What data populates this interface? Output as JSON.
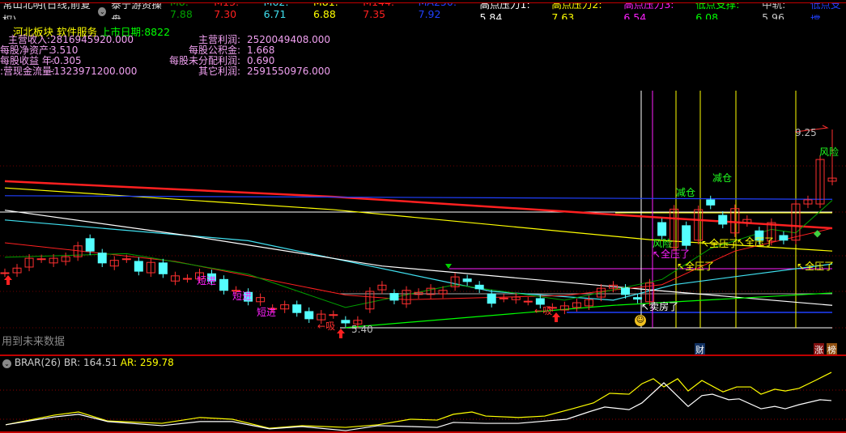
{
  "header": {
    "title": "常山北明(日线,前复权)",
    "indicator_name": "泰宁游资操盘",
    "items": [
      {
        "label": "M8: 7.88",
        "color": "#00a000"
      },
      {
        "label": "M13: 7.30",
        "color": "#ff2020"
      },
      {
        "label": "M62: 6.71",
        "color": "#40e0f0"
      },
      {
        "label": "M81: 6.88",
        "color": "#ffff00"
      },
      {
        "label": "M144: 7.35",
        "color": "#ff2020"
      },
      {
        "label": "MA250: 7.92",
        "color": "#2040ff"
      },
      {
        "label": "高点压力1: 5.84",
        "color": "#ffffff"
      },
      {
        "label": "高点压力2: 7.63",
        "color": "#ffff00"
      },
      {
        "label": "高点压力3: 6.54",
        "color": "#ff20ff"
      },
      {
        "label": "低点支撑: 6.08",
        "color": "#00ff00"
      },
      {
        "label": "中轨: 5.96",
        "color": "#c8c8c8"
      },
      {
        "label": "低点支撑",
        "color": "#2040ff"
      }
    ]
  },
  "info": {
    "sector": "河北板块",
    "industry": "软件服务",
    "listing": "上市日期:8822",
    "rows": [
      [
        "主营收入:",
        "2816945920.000",
        "主营利润:",
        "2520049408.000"
      ],
      [
        "每股净资产:",
        "3.510",
        "每股公积金:",
        "1.668"
      ],
      [
        "每股收益 年:",
        "-0.305",
        "每股未分配利润:",
        "0.690"
      ],
      [
        ":营现金流量:",
        "-1323971200.000",
        "其它利润:",
        "2591550976.000"
      ]
    ]
  },
  "annotations": {
    "future_data": "用到未来数据",
    "high_price": "9.25",
    "low_price": "5.40",
    "risk": "风险",
    "reduce": "减仓",
    "full": "全压了",
    "sell_house": "卖房了",
    "short_in": "短进",
    "absorb": "吸",
    "cai": "财",
    "zhang": "涨",
    "bang": "榜"
  },
  "brar": {
    "title": "BRAR(26)",
    "br": "BR: 164.51",
    "ar": "AR: 259.78"
  },
  "colors": {
    "up": "#ff3030",
    "down": "#54ffff",
    "bg": "#000000"
  },
  "chart_data": {
    "type": "candlestick",
    "price_range": [
      5.4,
      9.25
    ],
    "candles": [
      [
        6.48,
        6.48
      ],
      [
        6.48,
        6.57
      ],
      [
        6.59,
        6.76
      ],
      [
        6.75,
        6.75
      ],
      [
        6.67,
        6.76
      ],
      [
        6.7,
        6.79
      ],
      [
        6.79,
        7.0
      ],
      [
        7.14,
        6.9
      ],
      [
        6.86,
        6.67
      ],
      [
        6.61,
        6.72
      ],
      [
        6.75,
        6.75
      ],
      [
        6.7,
        6.51
      ],
      [
        6.48,
        6.68
      ],
      [
        6.67,
        6.46
      ],
      [
        6.32,
        6.42
      ],
      [
        6.37,
        6.37
      ],
      [
        6.36,
        6.48
      ],
      [
        6.46,
        6.32
      ],
      [
        6.35,
        6.14
      ],
      [
        6.14,
        6.14
      ],
      [
        6.1,
        5.93
      ],
      [
        5.92,
        6.0
      ],
      [
        5.79,
        5.79
      ],
      [
        5.78,
        5.86
      ],
      [
        5.86,
        5.71
      ],
      [
        5.73,
        5.59
      ],
      [
        5.57,
        5.68
      ],
      [
        5.67,
        5.67
      ],
      [
        5.56,
        5.51
      ],
      [
        5.49,
        5.56
      ],
      [
        5.78,
        6.12
      ],
      [
        6.15,
        6.24
      ],
      [
        6.08,
        5.95
      ],
      [
        5.88,
        6.14
      ],
      [
        6.06,
        6.1
      ],
      [
        6.06,
        6.18
      ],
      [
        6.07,
        6.14
      ],
      [
        6.21,
        6.4
      ],
      [
        6.36,
        6.31
      ],
      [
        6.24,
        6.17
      ],
      [
        6.07,
        5.89
      ],
      [
        5.99,
        5.99
      ],
      [
        5.96,
        6.01
      ],
      [
        5.93,
        5.93
      ],
      [
        5.98,
        5.87
      ],
      [
        5.81,
        5.81
      ],
      [
        5.76,
        5.84
      ],
      [
        5.81,
        5.9
      ],
      [
        5.84,
        5.96
      ],
      [
        6.01,
        6.18
      ],
      [
        6.18,
        6.24
      ],
      [
        6.18,
        6.06
      ],
      [
        6.0,
        5.97
      ],
      [
        5.92,
        6.28
      ],
      [
        7.45,
        7.2
      ],
      [
        6.97,
        7.71
      ],
      [
        7.39,
        7.01
      ],
      [
        7.11,
        7.7
      ],
      [
        7.89,
        7.79
      ],
      [
        7.59,
        7.42
      ],
      [
        7.25,
        7.72
      ],
      [
        7.45,
        7.51
      ],
      [
        7.29,
        7.11
      ],
      [
        7.09,
        7.45
      ],
      [
        7.2,
        7.11
      ],
      [
        7.11,
        7.81
      ],
      [
        7.81,
        7.89
      ],
      [
        7.81,
        8.67
      ],
      [
        8.25,
        8.31
      ]
    ],
    "lines": [
      {
        "name": "M144",
        "color": "#ff2020",
        "width": 2.5,
        "points": [
          [
            0,
            8.25
          ],
          [
            27,
            7.95
          ],
          [
            53,
            7.56
          ],
          [
            68,
            7.34
          ]
        ]
      },
      {
        "name": "M81",
        "color": "#ffff00",
        "width": 1.2,
        "points": [
          [
            0,
            8.12
          ],
          [
            27,
            7.7
          ],
          [
            53,
            7.12
          ],
          [
            68,
            6.9
          ]
        ]
      },
      {
        "name": "MA250",
        "color": "#2040ff",
        "width": 1.2,
        "points": [
          [
            0,
            7.97
          ],
          [
            40,
            7.93
          ],
          [
            68,
            7.9
          ]
        ]
      },
      {
        "name": "M62",
        "color": "#40e0f0",
        "width": 1.2,
        "points": [
          [
            0,
            7.5
          ],
          [
            20,
            7.1
          ],
          [
            40,
            6.12
          ],
          [
            50,
            5.95
          ],
          [
            55,
            6.25
          ],
          [
            68,
            6.65
          ]
        ]
      },
      {
        "name": "mid",
        "color": "#ffffff",
        "width": 1.2,
        "points": [
          [
            0,
            7.69
          ],
          [
            15,
            7.2
          ],
          [
            31,
            6.61
          ],
          [
            53,
            6.15
          ],
          [
            68,
            5.85
          ]
        ]
      },
      {
        "name": "M13",
        "color": "#ff2020",
        "width": 1,
        "points": [
          [
            0,
            7.06
          ],
          [
            14,
            6.7
          ],
          [
            28,
            6.05
          ],
          [
            33,
            5.96
          ],
          [
            46,
            6.04
          ],
          [
            54,
            6.25
          ],
          [
            60,
            6.9
          ],
          [
            68,
            7.34
          ]
        ]
      },
      {
        "name": "M8",
        "color": "#00a000",
        "width": 1,
        "points": [
          [
            0,
            6.78
          ],
          [
            10,
            6.85
          ],
          [
            20,
            6.45
          ],
          [
            28,
            5.81
          ],
          [
            37,
            6.25
          ],
          [
            46,
            5.95
          ],
          [
            54,
            6.35
          ],
          [
            58,
            6.95
          ],
          [
            63,
            7.32
          ],
          [
            65,
            7.25
          ],
          [
            68,
            7.88
          ]
        ]
      },
      {
        "name": "support",
        "color": "#00ff00",
        "width": 1.2,
        "points": [
          [
            28,
            5.42
          ],
          [
            50,
            5.85
          ],
          [
            68,
            6.09
          ]
        ]
      }
    ],
    "brar": {
      "range": [
        50,
        280
      ],
      "series": [
        {
          "name": "AR",
          "color": "#ffff00",
          "x": [
            7,
            67,
            97,
            133,
            200,
            247,
            287,
            333,
            373,
            427,
            467,
            507,
            540,
            560,
            583,
            600,
            640,
            673,
            707,
            733,
            753,
            777,
            793,
            807,
            820,
            837,
            850,
            867,
            893,
            910,
            927,
            940,
            957,
            970,
            987,
            1007,
            1027
          ],
          "y": [
            81,
            114,
            125,
            94,
            86,
            106,
            100,
            69,
            78,
            72,
            81,
            100,
            97,
            117,
            125,
            111,
            106,
            111,
            136,
            156,
            189,
            186,
            222,
            239,
            211,
            239,
            197,
            233,
            194,
            211,
            211,
            186,
            203,
            197,
            206,
            233,
            261
          ]
        },
        {
          "name": "BR",
          "color": "#ffffff",
          "x": [
            7,
            67,
            97,
            133,
            200,
            247,
            287,
            333,
            373,
            427,
            467,
            507,
            540,
            560,
            600,
            640,
            700,
            727,
            747,
            777,
            793,
            820,
            850,
            867,
            880,
            900,
            913,
            940,
            957,
            970,
            987,
            1013,
            1027
          ],
          "y": [
            81,
            108,
            117,
            92,
            78,
            92,
            92,
            67,
            75,
            61,
            78,
            75,
            72,
            89,
            86,
            86,
            100,
            125,
            142,
            133,
            156,
            225,
            144,
            181,
            186,
            167,
            170,
            136,
            144,
            136,
            150,
            167,
            164
          ]
        }
      ]
    }
  }
}
